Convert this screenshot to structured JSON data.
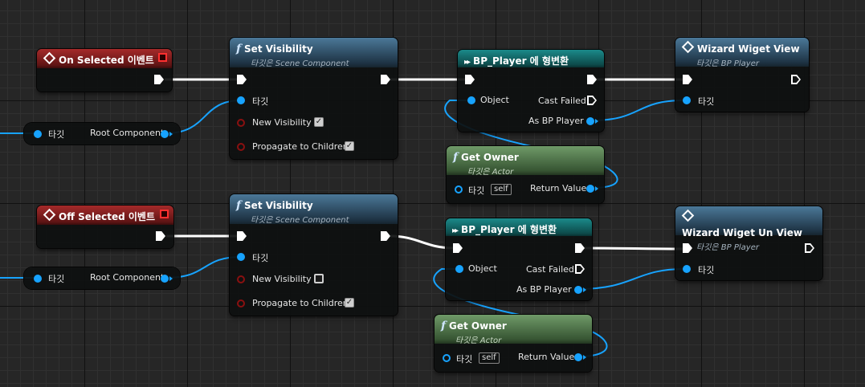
{
  "events": [
    {
      "title": "On Selected 이벤트"
    },
    {
      "title": "Off Selected 이벤트"
    }
  ],
  "set_visibility": [
    {
      "title": "Set Visibility",
      "subtitle": "타깃은 Scene Component",
      "target": "타깃",
      "new_visibility": "New Visibility",
      "new_visibility_checked": true,
      "propagate": "Propagate to Children",
      "propagate_checked": true
    },
    {
      "title": "Set Visibility",
      "subtitle": "타깃은 Scene Component",
      "target": "타깃",
      "new_visibility": "New Visibility",
      "new_visibility_checked": false,
      "propagate": "Propagate to Children",
      "propagate_checked": true
    }
  ],
  "cast": [
    {
      "title": "BP_Player 에 형변환",
      "object": "Object",
      "cast_failed": "Cast Failed",
      "as_player": "As BP Player"
    },
    {
      "title": "BP_Player 에 형변환",
      "object": "Object",
      "cast_failed": "Cast Failed",
      "as_player": "As BP Player"
    }
  ],
  "get_owner": [
    {
      "title": "Get Owner",
      "subtitle": "타깃은 Actor",
      "target": "타깃",
      "self": "self",
      "return_value": "Return Value"
    },
    {
      "title": "Get Owner",
      "subtitle": "타깃은 Actor",
      "target": "타깃",
      "self": "self",
      "return_value": "Return Value"
    }
  ],
  "widgets": [
    {
      "title": "Wizard Wiget View",
      "subtitle": "타깃은 BP Player",
      "target": "타깃"
    },
    {
      "title": "Wizard Wiget Un View",
      "subtitle": "타깃은 BP Player",
      "target": "타깃"
    }
  ],
  "component_refs": [
    {
      "target": "타깃",
      "output": "Root Component"
    },
    {
      "target": "타깃",
      "output": "Root Component"
    }
  ],
  "colors": {
    "exec": "#ffffff",
    "object_pin": "#17a3ff",
    "bool_pin": "#8a1010",
    "event_header": "#a52a2a",
    "function_header": "#4b7898",
    "cast_header": "#1b8a8a",
    "pure_header": "#6f9a68"
  }
}
